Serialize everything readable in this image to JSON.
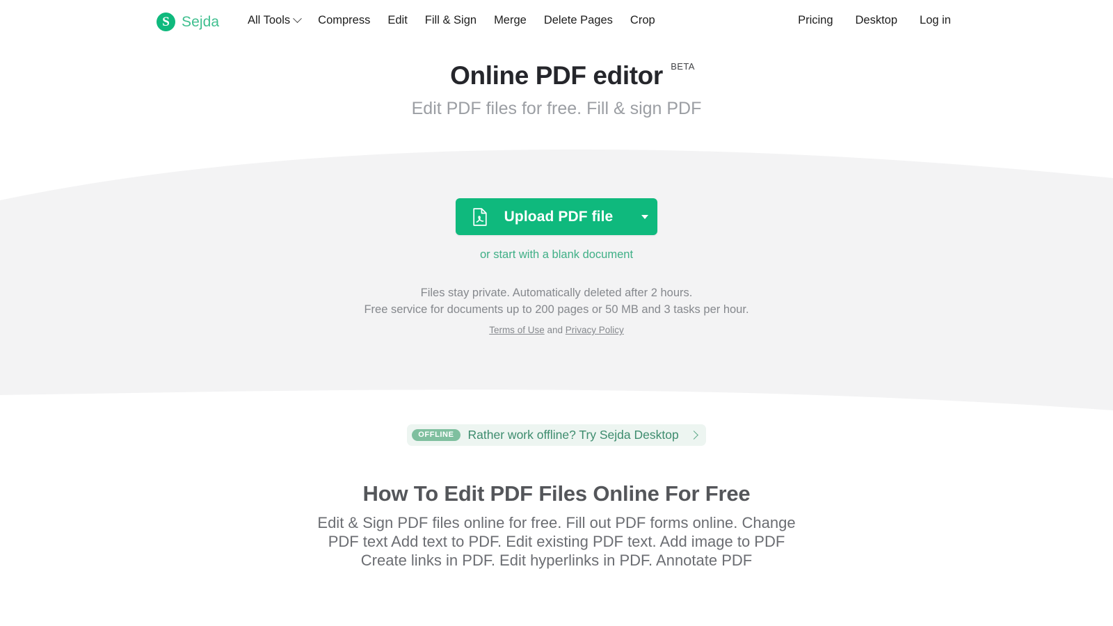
{
  "brand": {
    "mark": "S",
    "name": "Sejda",
    "logo_color": "#0FB97D",
    "name_color": "#3FBF8F"
  },
  "nav": {
    "main": [
      {
        "label": "All Tools",
        "has_caret": true
      },
      {
        "label": "Compress",
        "has_caret": false
      },
      {
        "label": "Edit",
        "has_caret": false
      },
      {
        "label": "Fill & Sign",
        "has_caret": false
      },
      {
        "label": "Merge",
        "has_caret": false
      },
      {
        "label": "Delete Pages",
        "has_caret": false
      },
      {
        "label": "Crop",
        "has_caret": false
      }
    ],
    "right": [
      {
        "label": "Pricing"
      },
      {
        "label": "Desktop"
      },
      {
        "label": "Log in"
      }
    ]
  },
  "hero": {
    "title": "Online PDF editor",
    "beta": "BETA",
    "subtitle": "Edit PDF files for free. Fill & sign PDF"
  },
  "upload": {
    "button_label": "Upload PDF file",
    "icon": "pdf-file-icon",
    "dropdown_icon": "caret-down-icon",
    "blank_doc_link": "or start with a blank document",
    "accent_color": "#0FB97D",
    "link_color": "#3FAF86"
  },
  "fineprint": {
    "line1": "Files stay private. Automatically deleted after 2 hours.",
    "line2": "Free service for documents up to 200 pages or 50 MB and 3 tasks per hour.",
    "terms_label": "Terms of Use",
    "and_label": "and",
    "privacy_label": "Privacy Policy"
  },
  "offline": {
    "badge": "OFFLINE",
    "text": "Rather work offline? Try Sejda Desktop",
    "chevron": "chevron-right-icon",
    "badge_bg": "#7FBF9F",
    "banner_bg": "#EDF5F1",
    "text_color": "#3D8C6E"
  },
  "bottom": {
    "title": "How To Edit PDF Files Online For Free",
    "description": "Edit & Sign PDF files online for free. Fill out PDF forms online. Change PDF text Add text to PDF. Edit existing PDF text. Add image to PDF Create links in PDF. Edit hyperlinks in PDF. Annotate PDF"
  },
  "decor": {
    "band_color": "#F3F3F4"
  }
}
